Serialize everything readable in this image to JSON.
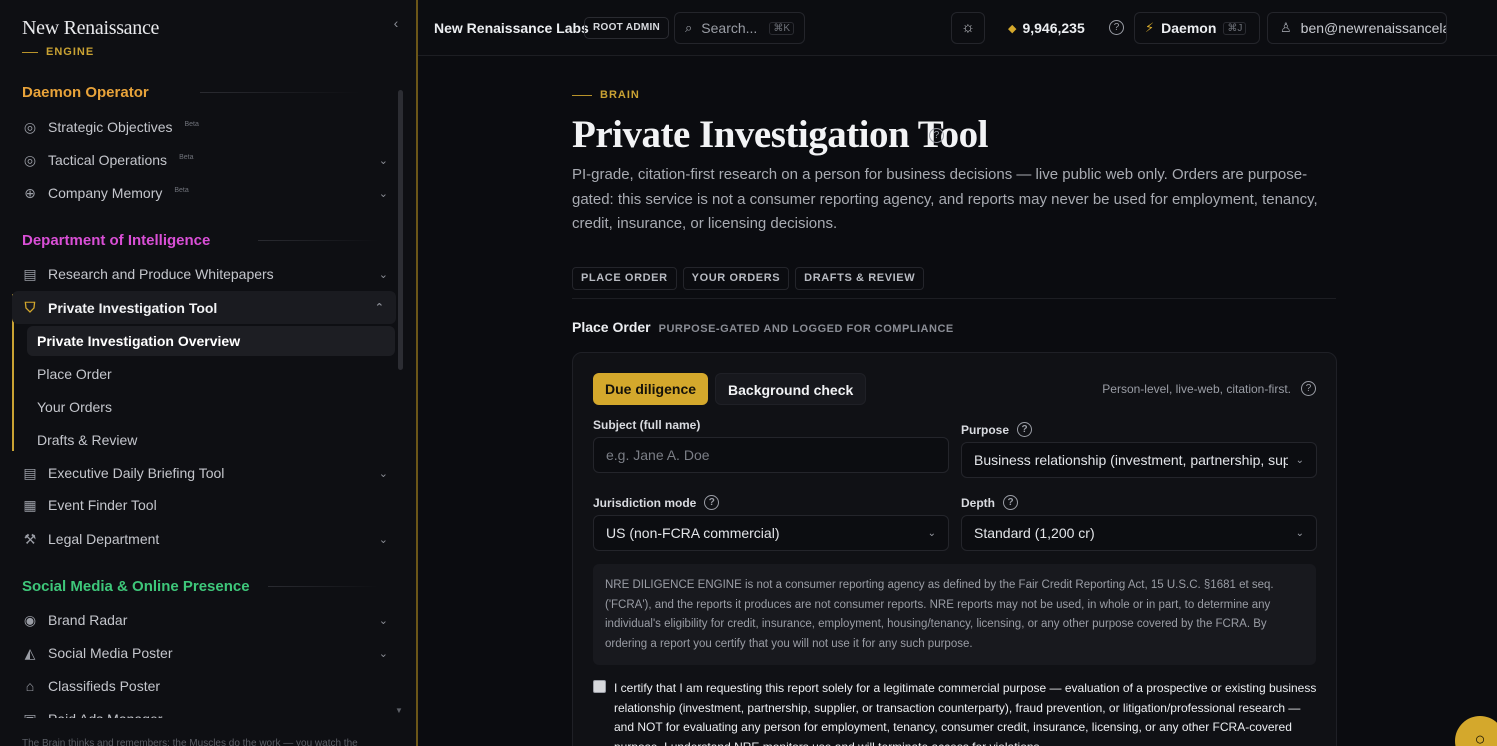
{
  "brand": {
    "name": "New Renaissance",
    "sub": "ENGINE"
  },
  "sidebar": {
    "sections": [
      {
        "title": "Daemon Operator",
        "color": "#e8a33a"
      },
      {
        "title": "Department of Intelligence",
        "color": "#d94fd6"
      },
      {
        "title": "Social Media & Online Presence",
        "color": "#3ec77a"
      }
    ],
    "items": {
      "strategic": {
        "label": "Strategic Objectives",
        "badge": "Beta",
        "icon": "target-icon"
      },
      "tactical": {
        "label": "Tactical Operations",
        "badge": "Beta",
        "icon": "target-icon"
      },
      "memory": {
        "label": "Company Memory",
        "badge": "Beta",
        "icon": "brain-icon"
      },
      "research": {
        "label": "Research and Produce Whitepapers",
        "icon": "document-icon"
      },
      "pi": {
        "label": "Private Investigation Tool",
        "icon": "shield-icon"
      },
      "briefing": {
        "label": "Executive Daily Briefing Tool",
        "icon": "document-icon"
      },
      "events": {
        "label": "Event Finder Tool",
        "icon": "calendar-icon"
      },
      "legal": {
        "label": "Legal Department",
        "icon": "gavel-icon"
      },
      "brand_radar": {
        "label": "Brand Radar",
        "icon": "radar-icon"
      },
      "social_poster": {
        "label": "Social Media Poster",
        "icon": "megaphone-icon"
      },
      "classifieds": {
        "label": "Classifieds Poster",
        "icon": "store-icon"
      },
      "paid_ads": {
        "label": "Paid Ads Manager",
        "icon": "ads-icon"
      }
    },
    "sub_items": [
      "Private Investigation Overview",
      "Place Order",
      "Your Orders",
      "Drafts & Review"
    ],
    "footer": "The Brain thinks and remembers; the Muscles do the work — you watch the"
  },
  "topbar": {
    "org": "New Renaissance Labs",
    "role": "ROOT ADMIN",
    "search_placeholder": "Search...",
    "search_kbd": "⌘K",
    "credits": "9,946,235",
    "daemon": "Daemon",
    "daemon_kbd": "⌘J",
    "user": "ben@newrenaissancela..."
  },
  "page": {
    "eyebrow": "BRAIN",
    "title": "Private Investigation Tool",
    "description": "PI-grade, citation-first research on a person for business decisions — live public web only. Orders are purpose-gated: this service is not a consumer reporting agency, and reports may never be used for employment, tenancy, credit, insurance, or licensing decisions.",
    "tabs": [
      "PLACE ORDER",
      "YOUR ORDERS",
      "DRAFTS & REVIEW"
    ],
    "section_title": "Place Order",
    "section_sub": "PURPOSE-GATED AND LOGGED FOR COMPLIANCE"
  },
  "form": {
    "mode_on": "Due diligence",
    "mode_off": "Background check",
    "hint": "Person-level, live-web, citation-first.",
    "subject_label": "Subject (full name)",
    "subject_placeholder": "e.g. Jane A. Doe",
    "purpose_label": "Purpose",
    "purpose_value": "Business relationship (investment, partnership, supplier)",
    "jurisdiction_label": "Jurisdiction mode",
    "jurisdiction_value": "US (non-FCRA commercial)",
    "depth_label": "Depth",
    "depth_value": "Standard (1,200 cr)",
    "disclaimer": "NRE DILIGENCE ENGINE is not a consumer reporting agency as defined by the Fair Credit Reporting Act, 15 U.S.C. §1681 et seq. ('FCRA'), and the reports it produces are not consumer reports. NRE reports may not be used, in whole or in part, to determine any individual's eligibility for credit, insurance, employment, housing/tenancy, licensing, or any other purpose covered by the FCRA. By ordering a report you certify that you will not use it for any such purpose.",
    "certify": "I certify that I am requesting this report solely for a legitimate commercial purpose — evaluation of a prospective or existing business relationship (investment, partnership, supplier, or transaction counterparty), fraud prevention, or litigation/professional research — and NOT for evaluating any person for employment, tenancy, consumer credit, insurance, licensing, or any other FCRA-covered purpose. I understand NRE monitors use and will terminate access for violations."
  }
}
